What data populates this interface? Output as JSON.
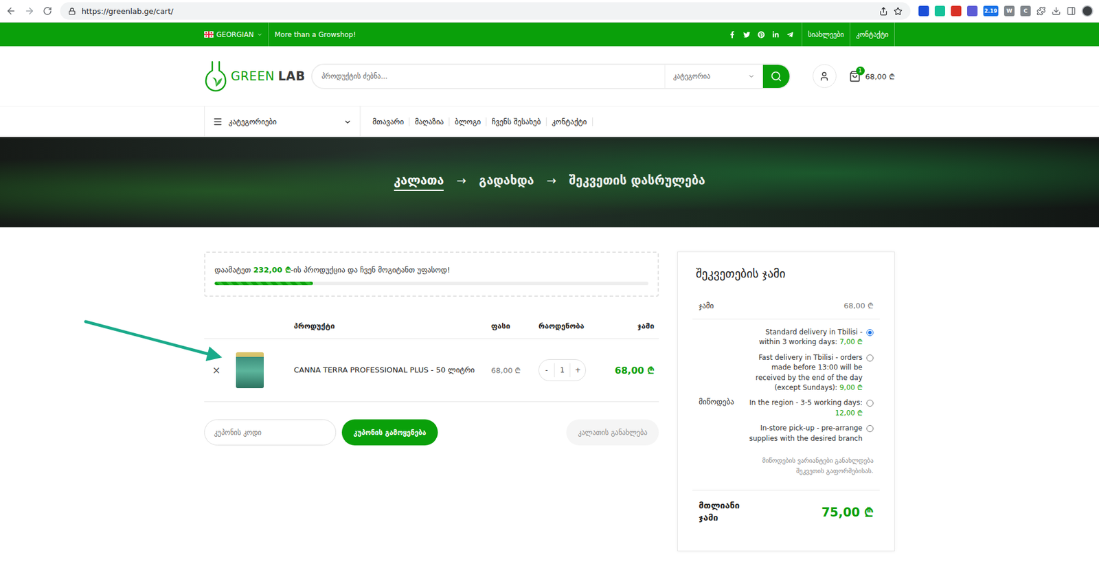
{
  "browser": {
    "url": "https://greenlab.ge/cart/",
    "extensions": [
      {
        "color": "#1b4fd8"
      },
      {
        "color": "#15c39a"
      },
      {
        "color": "#d93025"
      },
      {
        "color": "#5b5bd6"
      },
      {
        "color": "#1a73e8",
        "label": "2.19"
      },
      {
        "color": "#80868b",
        "label": "W"
      },
      {
        "color": "#80868b",
        "label": "C"
      }
    ]
  },
  "topbar": {
    "language": "GEORGIAN",
    "tagline": "More than a Growshop!",
    "links": [
      "სიახლეები",
      "კონტაქტი"
    ]
  },
  "header": {
    "brand": [
      "GREEN",
      "LAB"
    ],
    "search_placeholder": "პროდუქტის ძებნა...",
    "category_select": "კატეგორია",
    "cart_count": "1",
    "cart_total": "68,00 ₾"
  },
  "nav": {
    "categories_label": "კატეგორიები",
    "links": [
      "მთავარი",
      "მაღაზია",
      "ბლოგი",
      "ჩვენს შესახებ",
      "კონტაქტი"
    ]
  },
  "steps": [
    {
      "label": "კალათა",
      "selected": true
    },
    {
      "label": "გადახდა",
      "selected": false
    },
    {
      "label": "შეკვეთის დასრულება",
      "selected": false
    }
  ],
  "step_separator": "→",
  "free_shipping": {
    "prefix": "დაამატეთ ",
    "amount": "232,00 ₾",
    "suffix": "-ის პროდუქცია და ჩვენ მოგიტანთ უფასოდ!",
    "level": 0.227
  },
  "table": {
    "columns": [
      "პროდუქტი",
      "ფასი",
      "რაოდენობა",
      "ჯამი"
    ],
    "rows": [
      {
        "remove": "×",
        "name": "CANNA TERRA PROFESSIONAL PLUS - 50 ლიტრი",
        "price": "68,00 ₾",
        "quantity": "1",
        "decrement": "-",
        "increment": "+",
        "subtotal": "68,00 ₾"
      }
    ]
  },
  "coupon": {
    "placeholder": "კუპონის კოდი",
    "apply": "კუპონის გამოყენება",
    "update": "კალათის განახლება",
    "update_disabled": true
  },
  "totals": {
    "title": "შეკვეთების ჯამი",
    "subtotal_label": "ჯამი",
    "subtotal": "68,00 ₾",
    "delivery_label": "მიწოდება",
    "delivery_options": [
      {
        "label": "Standard delivery in Tbilisi - within 3 working days: ",
        "price": "7,00 ₾",
        "selected": true
      },
      {
        "label": "Fast delivery in Tbilisi - orders made before 13:00 will be received by the end of the day (except Sundays): ",
        "price": "9,00 ₾",
        "selected": false
      },
      {
        "label": "In the region - 3-5 working days: ",
        "price": "12,00 ₾",
        "selected": false
      },
      {
        "label": "In-store pick-up - pre-arrange supplies with the desired branch",
        "selected": false
      }
    ],
    "delivery_note": "მიწოდების ვარიანტები განახლდება შეკვეთის გაფორმებისას.",
    "total_label": "მთლიანი ჯამი",
    "total": "75,00 ₾"
  }
}
